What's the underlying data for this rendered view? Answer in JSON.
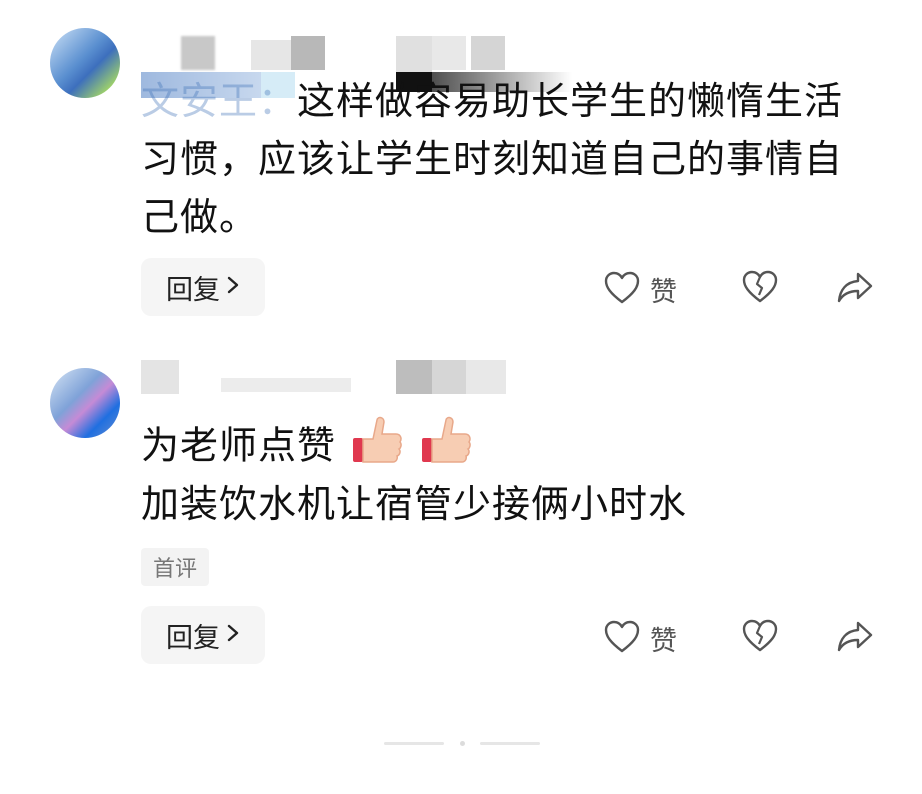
{
  "comments": [
    {
      "mention": "文安王：",
      "text": "这样做容易助长学生的懒惰生活习惯，应该让学生时刻知道自己的事情自己做。",
      "reply_label": "回复",
      "like_label": "赞"
    },
    {
      "text_line1": "为老师点赞",
      "text_line2": "加装饮水机让宿管少接俩小时水",
      "badge": "首评",
      "reply_label": "回复",
      "like_label": "赞"
    }
  ],
  "icons": {
    "reply_chevron": "chevron-right-icon",
    "like": "heart-outline-icon",
    "dislike": "broken-heart-icon",
    "share": "share-arrow-icon",
    "emoji": "thumbs-up-emoji"
  },
  "colors": {
    "mention": "#3b6fb6",
    "icon": "#555555"
  }
}
